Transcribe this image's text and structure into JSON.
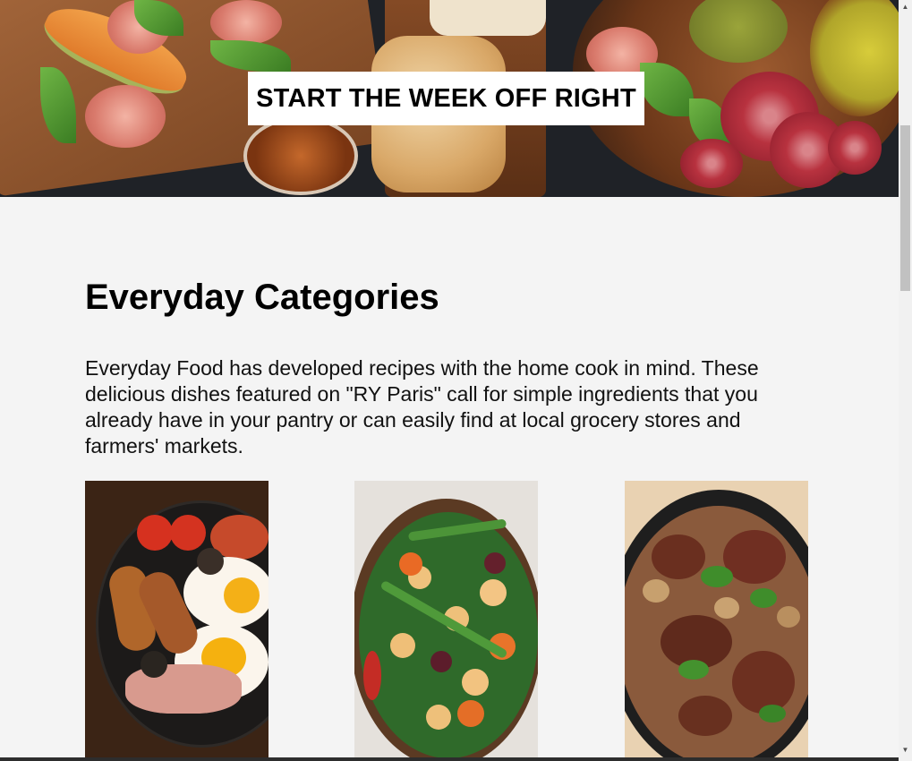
{
  "hero": {
    "title": "START THE WEEK OFF RIGHT"
  },
  "section": {
    "title": "Everyday Categories",
    "intro": "Everyday Food has developed recipes with the home cook in mind. These delicious dishes featured on \"RY Paris\" call for simple ingredients that you already have in your pantry or can easily find at local grocery stores and farmers' markets."
  },
  "cards": [
    {
      "image": "breakfast-skillet-photo"
    },
    {
      "image": "bean-salad-photo"
    },
    {
      "image": "mushroom-skillet-photo"
    }
  ],
  "scrollbar": {
    "up_icon": "triangle-up-icon",
    "down_icon": "triangle-down-icon"
  }
}
